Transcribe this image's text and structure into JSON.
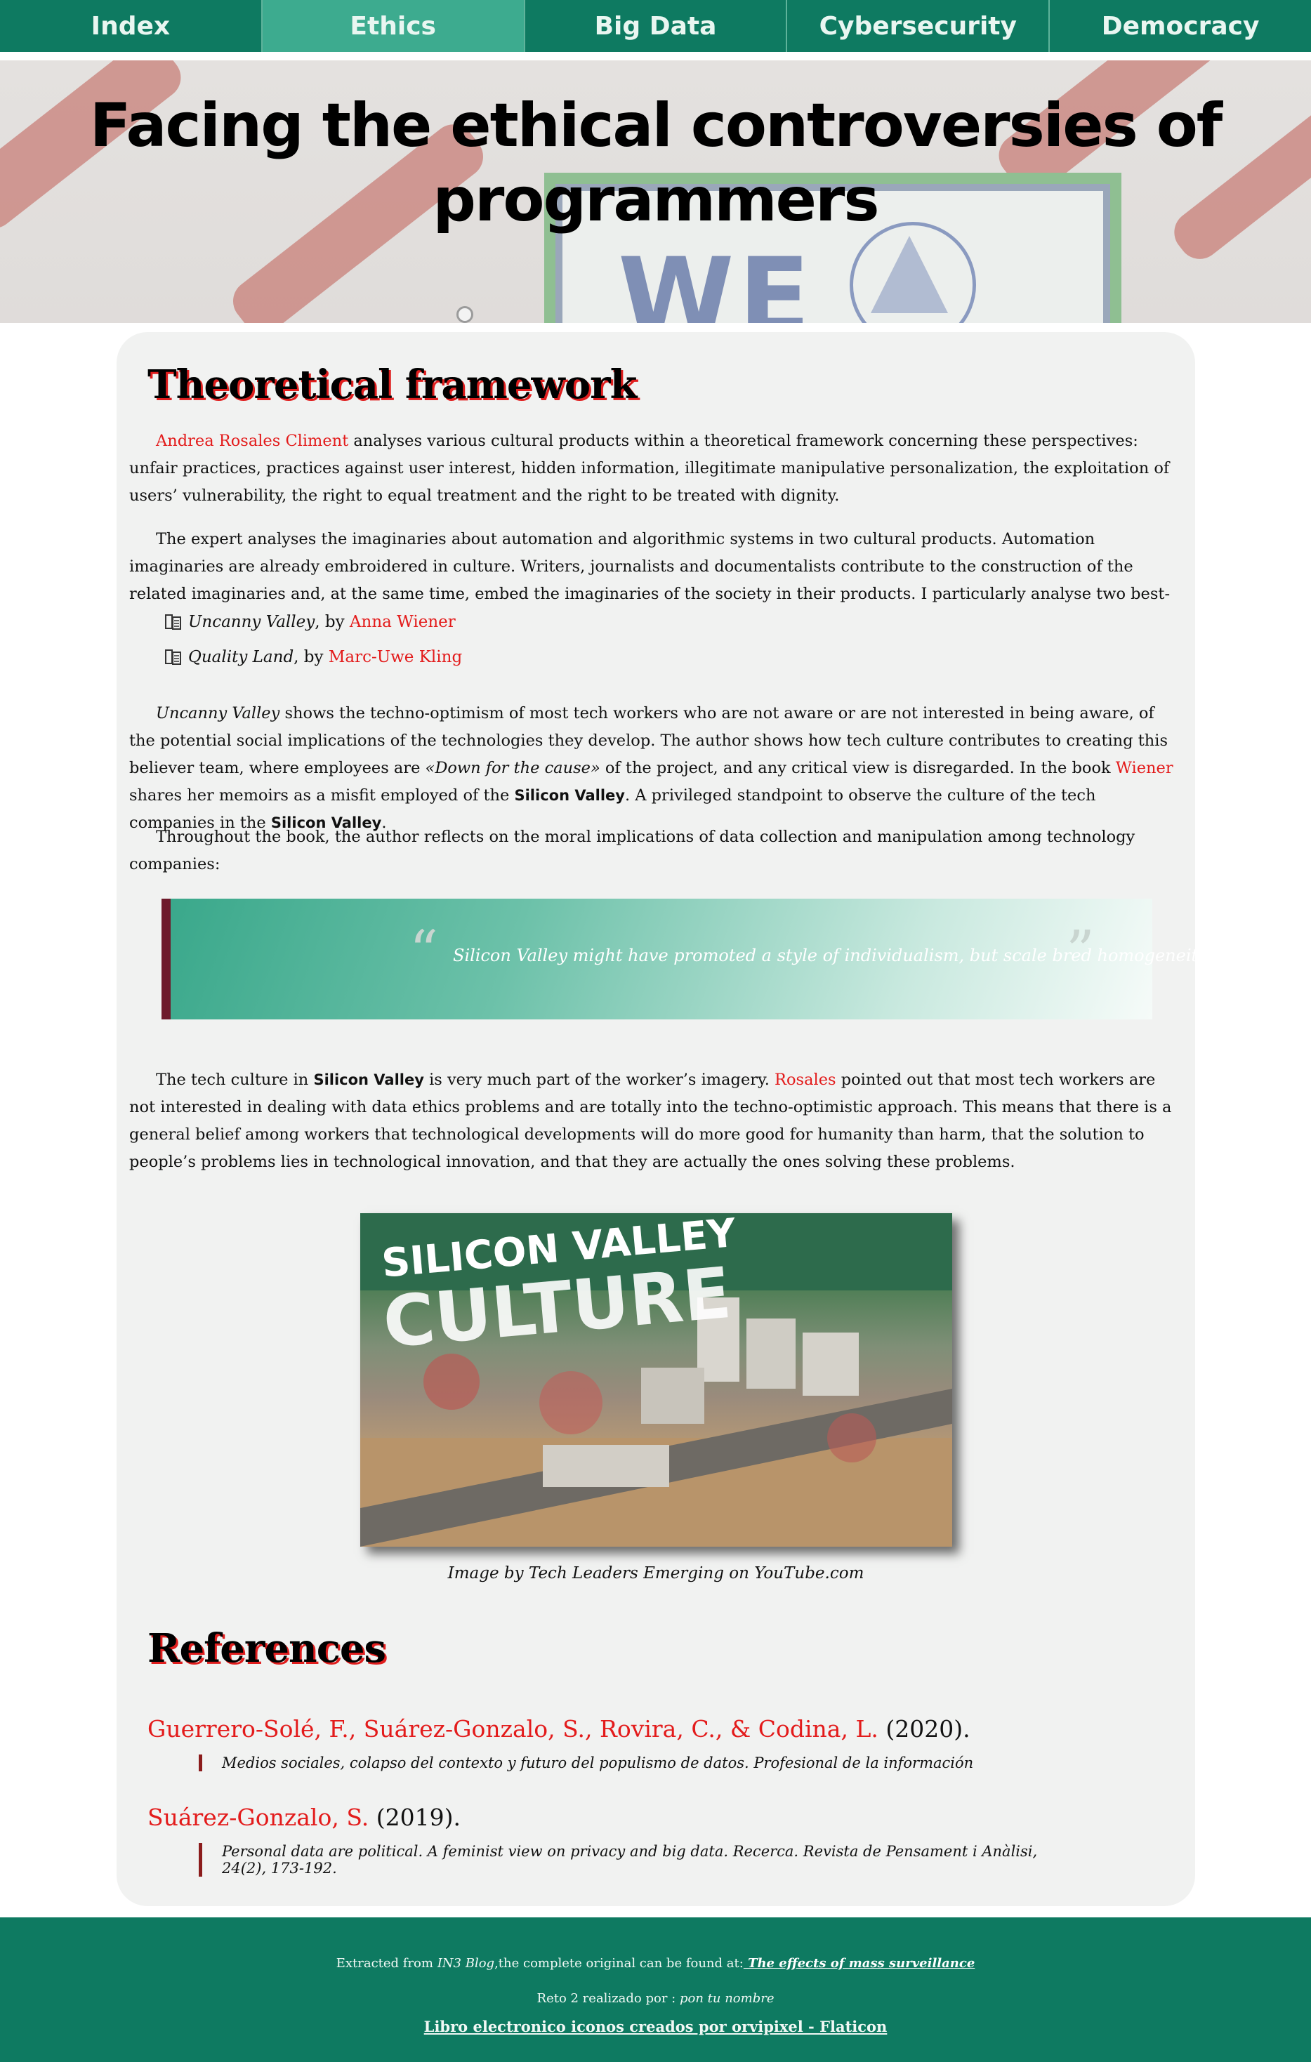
{
  "nav": {
    "items": [
      "Index",
      "Ethics",
      "Big Data",
      "Cybersecurity",
      "Democracy"
    ],
    "active": "Ethics"
  },
  "hero": {
    "title_line1": "Facing the ethical controversies of",
    "title_line2": "programmers",
    "sign_text": "WE"
  },
  "theory": {
    "heading": "Theoretical framework",
    "p1_author": "Andrea Rosales Climent",
    "p1_text": " analyses various cultural products within a theoretical framework concerning these perspectives: unfair practices, practices against user interest, hidden information, illegitimate manipulative personalization, the exploitation of users’ vulnerability, the right to equal treatment and the right to be treated with dignity.",
    "p2_text": "The expert analyses the imaginaries about automation and algorithmic systems in two cultural products. Automation imaginaries are already embroidered in culture. Writers, journalists and documentalists contribute to the construction of the related imaginaries and, at the same time, embed the imaginaries of the society in their products. I particularly analyse two best-seller books:",
    "books": [
      {
        "title": "Uncanny Valley",
        "by": ", by ",
        "author": "Anna Wiener"
      },
      {
        "title": "Quality Land",
        "by": ", by ",
        "author": "Marc-Uwe Kling"
      }
    ],
    "p3": {
      "title": "Uncanny Valley",
      "t1": " shows the techno-optimism of most tech workers who are not aware or are not interested in being aware, of the potential social implications of the technologies they develop. The author shows how tech culture contributes to creating this believer team, where employees are ",
      "quote": "«Down for the cause»",
      "t2": " of the project, and any critical view is disregarded. In the book ",
      "author": "Wiener",
      "t3": " shares her memoirs as a misfit employed of the ",
      "sv1": "Silicon Valley",
      "t4": ". A privileged standpoint to observe the culture of the tech companies in the ",
      "sv2": "Silicon Valley",
      "t5": "."
    },
    "p4_text": "Throughout the book, the author reflects on the moral implications of data collection and manipulation among technology companies:",
    "blockquote": {
      "open": "“",
      "text": "Silicon Valley might have promoted a style of individualism, but scale bred homogeneity",
      "close": "”"
    },
    "p5": {
      "t1": "The tech culture in ",
      "sv": "Silicon Valley",
      "t2": " is very much part of the worker’s imagery. ",
      "author": "Rosales",
      "t3": " pointed out that most tech workers are not interested in dealing with data ethics problems and are totally into the techno-optimistic approach. This means that there is a general belief among workers that technological developments will do more good for humanity than harm, that the solution to people’s problems lies in technological innovation, and that they are actually the ones solving these problems."
    },
    "figure": {
      "line1": "SILICON VALLEY",
      "line2": "CULTURE",
      "caption": "Image by Tech Leaders Emerging on YouTube.com"
    }
  },
  "references": {
    "heading": "References",
    "items": [
      {
        "authors": "Guerrero-Solé, F., Suárez-Gonzalo, S., Rovira, C., & Codina, L.",
        "year": " (2020).",
        "body": "Medios sociales, colapso del contexto y futuro del populismo de datos. Profesional de la información"
      },
      {
        "authors": "Suárez-Gonzalo, S.",
        "year": " (2019).",
        "body": "Personal data are political. A feminist view on privacy and big data. Recerca. Revista de Pensament i Anàlisi, 24(2), 173-192."
      }
    ]
  },
  "footer": {
    "l1_prefix": "Extracted from ",
    "l1_blog": "IN3 Blog",
    "l1_mid": ",the complete original can be found at:",
    "l1_link": " The effects of mass surveillance",
    "l2_prefix": "Reto 2 realizado por : ",
    "l2_name": "pon tu nombre",
    "l3_link": "Libro electronico iconos creados por orvipixel - Flaticon"
  },
  "colors": {
    "nav": "#0e7a61",
    "nav_active": "#3dab8f",
    "accent_red": "#e31b1b",
    "quote_border": "#6e1a2b",
    "card_bg": "#f1f2f1"
  },
  "icons": {
    "book": "book-icon"
  }
}
